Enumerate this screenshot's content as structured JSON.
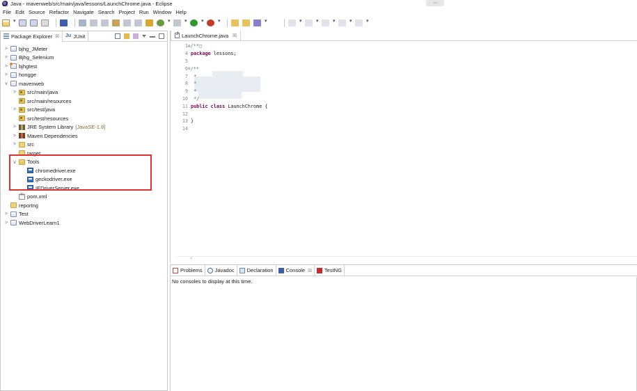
{
  "window": {
    "title": "Java - mavenweb/src/main/java/lessons/LaunchChrome.java - Eclipse",
    "ime_label": "⋯"
  },
  "menu": [
    "File",
    "Edit",
    "Source",
    "Refactor",
    "Navigate",
    "Search",
    "Project",
    "Run",
    "Window",
    "Help"
  ],
  "left_panel": {
    "tabs": [
      {
        "label": "Package Explorer",
        "close": "☒",
        "active": true
      },
      {
        "label": "JUnit",
        "icon_text": "Ju"
      }
    ],
    "tree": [
      {
        "label": "bjhg_JMeter",
        "twisty": ">",
        "icon": "project-icon",
        "indent": 0
      },
      {
        "label": "Bjhg_Selenium",
        "twisty": ">",
        "icon": "project-icon",
        "indent": 0
      },
      {
        "label": "bjhgtest",
        "twisty": ">",
        "icon": "java-project-icon",
        "indent": 0
      },
      {
        "label": "hongge",
        "twisty": ">",
        "icon": "project-icon",
        "indent": 0
      },
      {
        "label": "mavenweb",
        "twisty": "∨",
        "icon": "project-icon",
        "indent": 0
      },
      {
        "label": "src/main/java",
        "twisty": ">",
        "icon": "source-folder-icon",
        "indent": 1
      },
      {
        "label": "src/main/resources",
        "twisty": "",
        "icon": "source-folder-icon",
        "indent": 1
      },
      {
        "label": "src/test/java",
        "twisty": ">",
        "icon": "source-folder-icon",
        "indent": 1
      },
      {
        "label": "src/test/resources",
        "twisty": "",
        "icon": "source-folder-icon",
        "indent": 1
      },
      {
        "label": "JRE System Library",
        "deco": "[JavaSE-1.8]",
        "twisty": ">",
        "icon": "library-icon",
        "indent": 1
      },
      {
        "label": "Maven Dependencies",
        "twisty": ">",
        "icon": "maven-library-icon",
        "indent": 1
      },
      {
        "label": "src",
        "twisty": ">",
        "icon": "folder-icon",
        "indent": 1
      },
      {
        "label": "target",
        "twisty": "",
        "icon": "folder-icon",
        "indent": 1
      },
      {
        "label": "Tools",
        "twisty": "∨",
        "icon": "folder-open-icon",
        "indent": 1
      },
      {
        "label": "chromedriver.exe",
        "twisty": "",
        "icon": "exe-file-icon",
        "indent": 2
      },
      {
        "label": "geckodriver.exe",
        "twisty": "",
        "icon": "exe-file-icon",
        "indent": 2
      },
      {
        "label": "IEDriverServer.exe",
        "twisty": "",
        "icon": "exe-file-icon",
        "indent": 2
      },
      {
        "label": "pom.xml",
        "twisty": "",
        "icon": "xml-file-icon",
        "indent": 1
      },
      {
        "label": "reportng",
        "twisty": "",
        "icon": "folder-icon",
        "indent": 0
      },
      {
        "label": "Test",
        "twisty": ">",
        "icon": "project-icon",
        "indent": 0
      },
      {
        "label": "WebDriverLearn1",
        "twisty": ">",
        "icon": "project-icon",
        "indent": 0
      }
    ]
  },
  "editor": {
    "tab_label": "LaunchChrome.java",
    "tab_close": "☒",
    "lines": [
      {
        "n": "1",
        "fold": "⊕",
        "parts": [
          {
            "t": "/**",
            "c": "cm"
          },
          {
            "t": "□",
            "c": "cm"
          }
        ]
      },
      {
        "n": "4",
        "parts": [
          {
            "t": "package",
            "c": "kw"
          },
          {
            "t": " lessons;",
            "c": "tx"
          }
        ]
      },
      {
        "n": "5",
        "parts": []
      },
      {
        "n": "6",
        "fold": "⊖",
        "parts": [
          {
            "t": "/**",
            "c": "cm"
          }
        ]
      },
      {
        "n": "7",
        "parts": [
          {
            "t": " *",
            "c": "cm"
          }
        ]
      },
      {
        "n": "8",
        "parts": [
          {
            "t": " *",
            "c": "cm"
          }
        ]
      },
      {
        "n": "9",
        "parts": [
          {
            "t": " *",
            "c": "cm"
          }
        ]
      },
      {
        "n": "10",
        "parts": [
          {
            "t": " */",
            "c": "cm"
          }
        ]
      },
      {
        "n": "11",
        "parts": [
          {
            "t": "public",
            "c": "kw"
          },
          {
            "t": " ",
            "c": "tx"
          },
          {
            "t": "class",
            "c": "kw"
          },
          {
            "t": " LaunchChrome {",
            "c": "tx"
          }
        ]
      },
      {
        "n": "12",
        "parts": []
      },
      {
        "n": "13",
        "parts": [
          {
            "t": "}",
            "c": "tx"
          }
        ]
      },
      {
        "n": "14",
        "parts": []
      }
    ]
  },
  "console": {
    "tabs": [
      {
        "label": "Problems",
        "icon": "problems-icon"
      },
      {
        "label": "Javadoc",
        "icon": "javadoc-icon"
      },
      {
        "label": "Declaration",
        "icon": "declaration-icon"
      },
      {
        "label": "Console",
        "icon": "console-icon",
        "close": "☒",
        "active": true
      },
      {
        "label": "TestNG",
        "icon": "testng-icon"
      }
    ],
    "message": "No consoles to display at this time."
  },
  "colors": {
    "highlight_border": "#e0302f",
    "keyword": "#7f0055",
    "comment": "#3f7f5f"
  }
}
